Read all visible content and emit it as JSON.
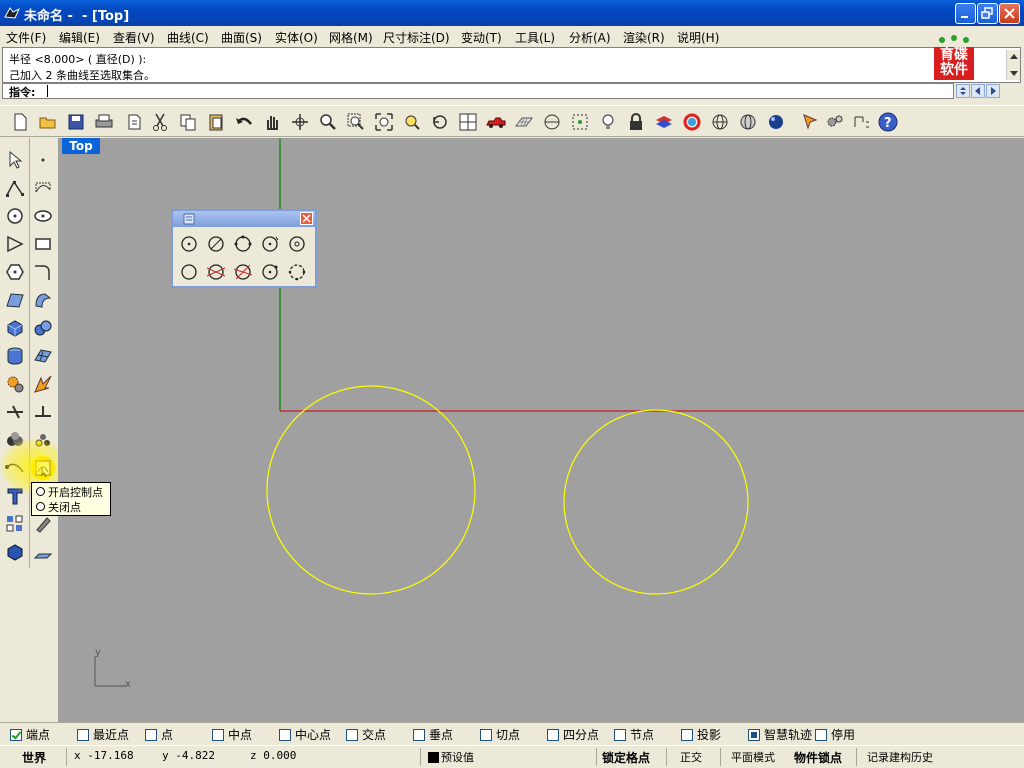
{
  "window": {
    "title": "未命名 -  - [Top]"
  },
  "menu": [
    {
      "label": "文件(F)"
    },
    {
      "label": "编辑(E)"
    },
    {
      "label": "查看(V)"
    },
    {
      "label": "曲线(C)"
    },
    {
      "label": "曲面(S)"
    },
    {
      "label": "实体(O)"
    },
    {
      "label": "网格(M)"
    },
    {
      "label": "尺寸标注(D)"
    },
    {
      "label": "变动(T)"
    },
    {
      "label": "工具(L)"
    },
    {
      "label": "分析(A)"
    },
    {
      "label": "渲染(R)"
    },
    {
      "label": "说明(H)"
    }
  ],
  "history": [
    "半径 <8.000> ( 直径(D) ):",
    "己加入 2 条曲线至选取集合。"
  ],
  "command": {
    "label": "指令:"
  },
  "logo": {
    "text": [
      "育碟",
      "软件"
    ],
    "color": "#d81e1e"
  },
  "toolbar_icons": [
    "new-file-icon",
    "open-folder-icon",
    "save-icon",
    "print-icon",
    "import-icon",
    "cut-icon",
    "copy-icon",
    "paste-icon",
    "undo-icon",
    "pan-hand-icon",
    "rotate-view-icon",
    "zoom-dynamic-icon",
    "zoom-window-icon",
    "zoom-extents-icon",
    "zoom-selected-icon",
    "undo-view-icon",
    "four-viewports-icon",
    "car-icon",
    "grid-icon",
    "cplane-icon",
    "osnap-icon",
    "lightbulb-icon",
    "lock-icon",
    "layer-icon",
    "color-wheel-icon",
    "wireframe-sphere-icon",
    "ghosted-sphere-icon",
    "render-sphere-icon",
    "arrow-marker-icon",
    "settings-gears-icon",
    "dimension-icon",
    "help-icon"
  ],
  "viewport": {
    "name": "Top",
    "axis_x": "x",
    "axis_y": "y"
  },
  "tooltip": {
    "items": [
      "开启控制点",
      "关闭点"
    ]
  },
  "osnaps": [
    {
      "label": "端点",
      "checked": true
    },
    {
      "label": "最近点",
      "checked": false
    },
    {
      "label": "点",
      "checked": false
    },
    {
      "label": "中点",
      "checked": false
    },
    {
      "label": "中心点",
      "checked": false
    },
    {
      "label": "交点",
      "checked": false
    },
    {
      "label": "垂点",
      "checked": false
    },
    {
      "label": "切点",
      "checked": false
    },
    {
      "label": "四分点",
      "checked": false
    },
    {
      "label": "节点",
      "checked": false
    },
    {
      "label": "投影",
      "checked": false
    },
    {
      "label": "智慧轨迹",
      "checked": true
    },
    {
      "label": "停用",
      "checked": false
    }
  ],
  "status": {
    "cplane": "世界",
    "x": "x -17.168",
    "y": "y -4.822",
    "z": "z 0.000",
    "layer": "预设值",
    "grid_snap": "锁定格点",
    "ortho": "正交",
    "planar": "平面模式",
    "osnap": "物件锁点",
    "history": "记录建构历史"
  },
  "colors": {
    "viewport_bg": "#a0a0a0",
    "curve": "#ffff00",
    "x_axis": "#c0303a",
    "y_axis": "#1f8a1f"
  }
}
